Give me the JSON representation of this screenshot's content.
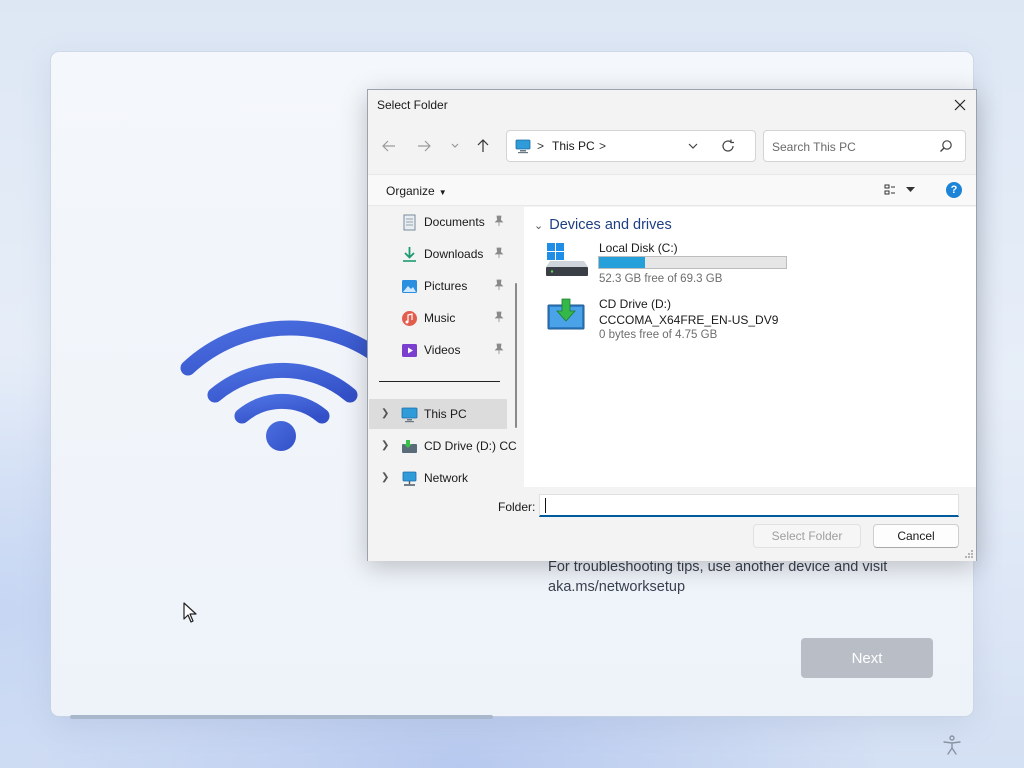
{
  "background": {
    "tip_line1": "For troubleshooting tips, use another device and visit",
    "tip_line2": "aka.ms/networksetup",
    "next_label": "Next"
  },
  "dialog": {
    "title": "Select Folder",
    "address": {
      "location": "This PC",
      "separator": ">"
    },
    "search": {
      "placeholder": "Search This PC"
    },
    "commandbar": {
      "organize_label": "Organize"
    },
    "nav": {
      "items": [
        {
          "label": "Documents",
          "icon": "documents-icon",
          "pinned": true
        },
        {
          "label": "Downloads",
          "icon": "downloads-icon",
          "pinned": true
        },
        {
          "label": "Pictures",
          "icon": "pictures-icon",
          "pinned": true
        },
        {
          "label": "Music",
          "icon": "music-icon",
          "pinned": true
        },
        {
          "label": "Videos",
          "icon": "videos-icon",
          "pinned": true
        },
        {
          "label": "This PC",
          "icon": "this-pc-icon",
          "selected": true
        },
        {
          "label": "CD Drive (D:) CC",
          "icon": "cd-drive-icon"
        },
        {
          "label": "Network",
          "icon": "network-icon"
        }
      ]
    },
    "content": {
      "group_title": "Devices and drives",
      "drives": [
        {
          "name": "Local Disk (C:)",
          "free": "52.3 GB free of 69.3 GB",
          "used_fraction": 0.245
        },
        {
          "name": "CD Drive (D:)",
          "volume": "CCCOMA_X64FRE_EN-US_DV9",
          "free": "0 bytes free of 4.75 GB"
        }
      ]
    },
    "footer": {
      "folder_label": "Folder:",
      "folder_value": "",
      "select_label": "Select Folder",
      "cancel_label": "Cancel"
    }
  },
  "colors": {
    "accent": "#1b84d8",
    "wifi": "#3f63d6",
    "progress_fill": "#26a0da"
  }
}
